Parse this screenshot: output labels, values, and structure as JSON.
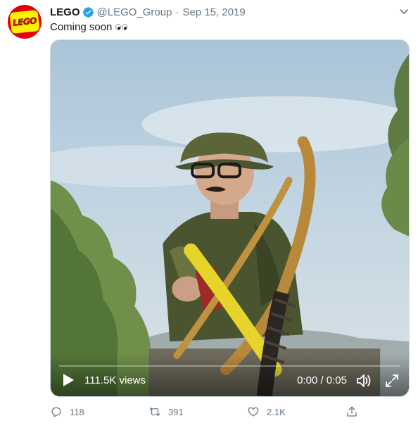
{
  "tweet": {
    "author_name": "LEGO",
    "avatar_logo_text": "LEGO",
    "handle": "@LEGO_Group",
    "separator": "·",
    "date": "Sep 15, 2019",
    "text": "Coming soon",
    "emoji": "eyes"
  },
  "video": {
    "views": "111.5K views",
    "time": "0:00 / 0:05",
    "progress": 0.0
  },
  "actions": {
    "reply_count": "118",
    "retweet_count": "391",
    "like_count": "2.1K"
  },
  "colors": {
    "lego_red": "#e3000b",
    "lego_yellow": "#fff200",
    "verified_blue": "#1da1f2",
    "muted_text": "#657786"
  },
  "icons": [
    "verified-badge-icon",
    "caret-down-icon",
    "play-icon",
    "volume-icon",
    "fullscreen-icon",
    "reply-icon",
    "retweet-icon",
    "like-icon",
    "share-icon"
  ]
}
